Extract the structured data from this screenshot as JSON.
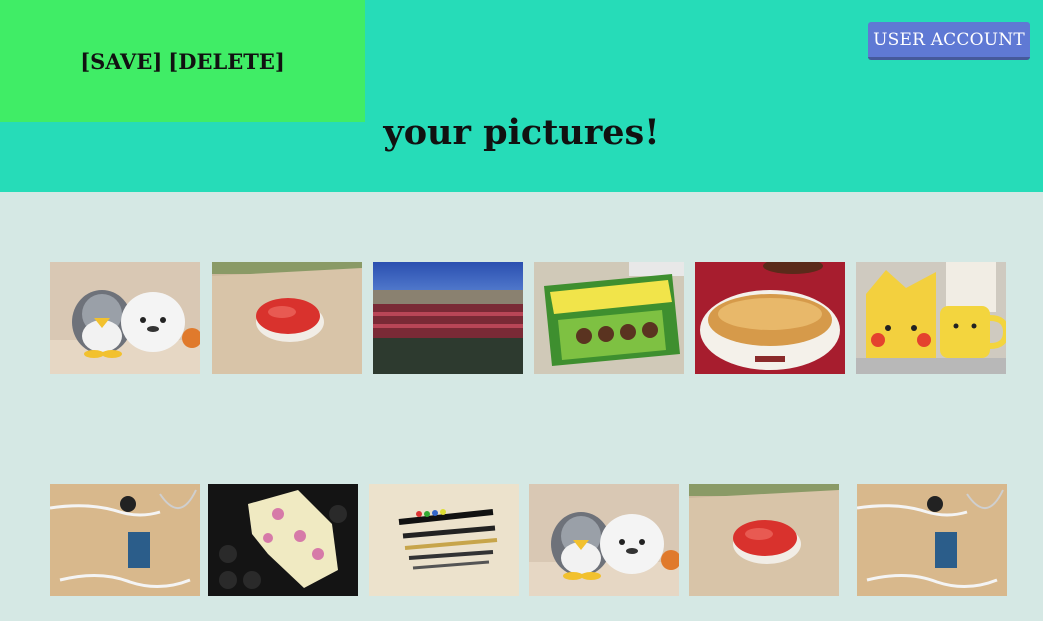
{
  "header": {
    "save_label": "[SAVE]",
    "delete_label": "[DELETE]",
    "user_account_label": "USER ACCOUNT",
    "title": "your pictures!"
  },
  "gallery": {
    "rows": [
      [
        "penguin-seal-plush",
        "tuna-sushi",
        "stadium",
        "takenoko-snack-box",
        "bread-plate",
        "pikachu-box-mug"
      ],
      [
        "earphones-cable",
        "takoyaki-pan",
        "pens-set",
        "penguin-seal-plush",
        "tuna-sushi",
        "earphones-cable"
      ]
    ]
  },
  "colors": {
    "header_bg": "#26dcb8",
    "action_panel_bg": "#40ed66",
    "button_bg": "#5f79d4",
    "page_bg": "#d5e8e4"
  }
}
